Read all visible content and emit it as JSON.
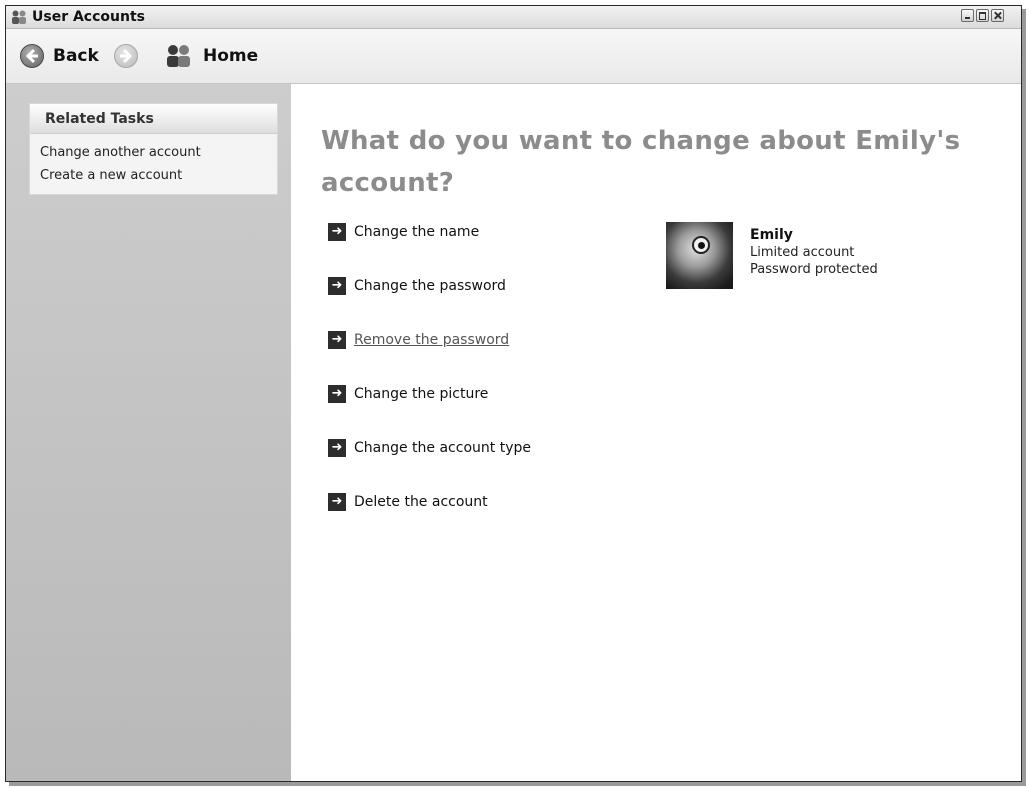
{
  "window": {
    "title": "User Accounts"
  },
  "toolbar": {
    "back_label": "Back",
    "home_label": "Home"
  },
  "sidebar": {
    "panel_title": "Related Tasks",
    "links": [
      "Change another account",
      "Create a new account"
    ]
  },
  "main": {
    "heading": "What do you want to change about Emily's account?",
    "tasks": [
      "Change the name",
      "Change the password",
      "Remove the password",
      "Change the picture",
      "Change the account type",
      "Delete the account"
    ]
  },
  "user": {
    "name": "Emily",
    "account_type": "Limited account",
    "password_status": "Password protected"
  },
  "icons": {
    "app": "users-icon",
    "back": "back-arrow-icon",
    "forward": "forward-arrow-icon",
    "home": "users-home-icon",
    "task": "arrow-right-icon"
  }
}
